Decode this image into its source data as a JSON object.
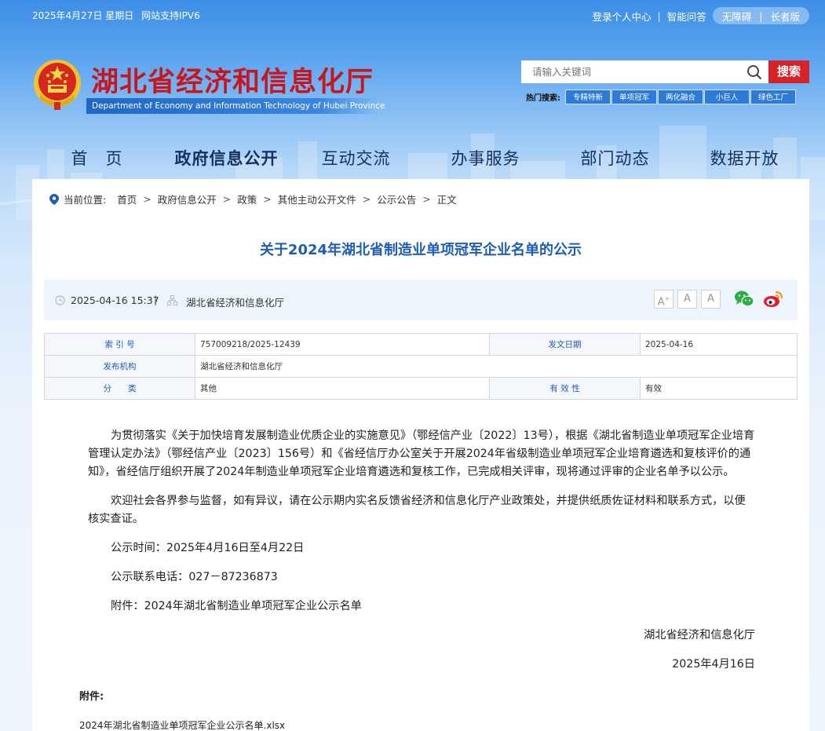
{
  "topbar": {
    "date": "2025年4月27日 星期日",
    "ipv6": "网站支持IPV6",
    "login": "登录个人中心",
    "qa": "智能问答",
    "accessibility": "无障碍",
    "elder": "长者版"
  },
  "header": {
    "title_cn": "湖北省经济和信息化厅",
    "title_en": "Department of Economy and Information Technology of Hubei Province",
    "search_placeholder": "请输入关键词",
    "search_button": "搜索",
    "hot_label": "热门搜索:",
    "hot_tags": [
      "专精特新",
      "单项冠军",
      "两化融合",
      "小巨人",
      "绿色工厂"
    ]
  },
  "nav": [
    "首　页",
    "政府信息公开",
    "互动交流",
    "办事服务",
    "部门动态",
    "数据开放"
  ],
  "breadcrumb": {
    "label": "当前位置:",
    "items": [
      "首页",
      "政府信息公开",
      "政策",
      "其他主动公开文件",
      "公示公告",
      "正文"
    ]
  },
  "article": {
    "title": "关于2024年湖北省制造业单项冠军企业名单的公示",
    "time": "2025-04-16 15:37",
    "source": "湖北省经济和信息化厅",
    "font_sizes": [
      "A",
      "A",
      "A"
    ],
    "info": {
      "index_label": "索 引 号",
      "index_value": "757009218/2025-12439",
      "date_label": "发文日期",
      "date_value": "2025-04-16",
      "org_label": "发布机构",
      "org_value": "湖北省经济和信息化厅",
      "cat_label": "分　　类",
      "cat_value": "其他",
      "valid_label": "有 效 性",
      "valid_value": "有效"
    },
    "para1": "为贯彻落实《关于加快培育发展制造业优质企业的实施意见》（鄂经信产业〔2022〕13号），根据《湖北省制造业单项冠军企业培育管理认定办法》（鄂经信产业〔2023〕156号）和《省经信厅办公室关于开展2024年省级制造业单项冠军企业培育遴选和复核评价的通知》，省经信厅组织开展了2024年制造业单项冠军企业培育遴选和复核工作，已完成相关评审，现将通过评审的企业名单予以公示。",
    "para2": "欢迎社会各界参与监督，如有异议，请在公示期内实名反馈省经济和信息化厅产业政策处，并提供纸质佐证材料和联系方式，以便核实查证。",
    "period": "公示时间：2025年4月16日至4月22日",
    "phone": "公示联系电话：027－87236873",
    "attachment_line": "附件：2024年湖北省制造业单项冠军企业公示名单",
    "signer": "湖北省经济和信息化厅",
    "sign_date": "2025年4月16日",
    "attach_label": "附件:",
    "attach_file": "2024年湖北省制造业单项冠军企业公示名单.xlsx"
  },
  "colors": {
    "brand_red": "#c8161d",
    "title_blue": "#1f5cb8",
    "nav_text": "#14305e"
  }
}
